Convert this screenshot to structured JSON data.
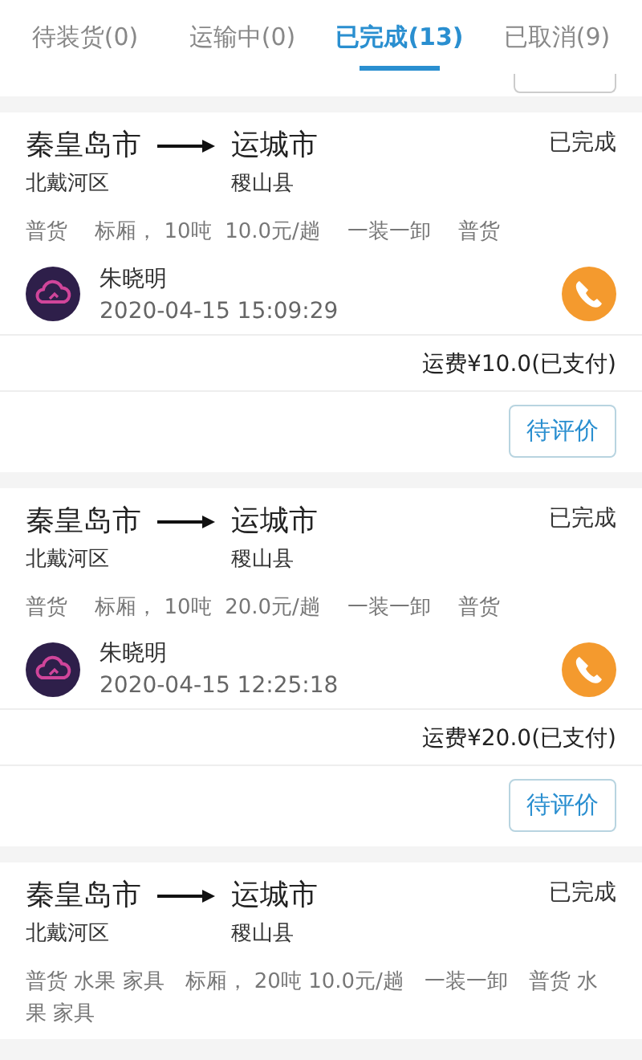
{
  "tabs": [
    {
      "label": "待装货(0)",
      "selected": false
    },
    {
      "label": "运输中(0)",
      "selected": false
    },
    {
      "label": "已完成(13)",
      "selected": true
    },
    {
      "label": "已取消(9)",
      "selected": false
    }
  ],
  "orders": [
    {
      "from_city": "秦皇岛市",
      "from_district": "北戴河区",
      "to_city": "运城市",
      "to_district": "稷山县",
      "status": "已完成",
      "cargo_lines": [
        "普货　 标厢， 10吨  10.0元/趟　 一装一卸　 普货"
      ],
      "driver": {
        "name": "朱晓明",
        "time": "2020-04-15 15:09:29"
      },
      "fee": "运费¥10.0(已支付)",
      "action": "待评价"
    },
    {
      "from_city": "秦皇岛市",
      "from_district": "北戴河区",
      "to_city": "运城市",
      "to_district": "稷山县",
      "status": "已完成",
      "cargo_lines": [
        "普货　 标厢， 10吨  20.0元/趟　 一装一卸　 普货"
      ],
      "driver": {
        "name": "朱晓明",
        "time": "2020-04-15 12:25:18"
      },
      "fee": "运费¥20.0(已支付)",
      "action": "待评价"
    },
    {
      "from_city": "秦皇岛市",
      "from_district": "北戴河区",
      "to_city": "运城市",
      "to_district": "稷山县",
      "status": "已完成",
      "cargo_lines": [
        "普货 水果 家具　标厢， 20吨 10.0元/趟　一装一卸　普货 水",
        "果 家具"
      ]
    }
  ]
}
